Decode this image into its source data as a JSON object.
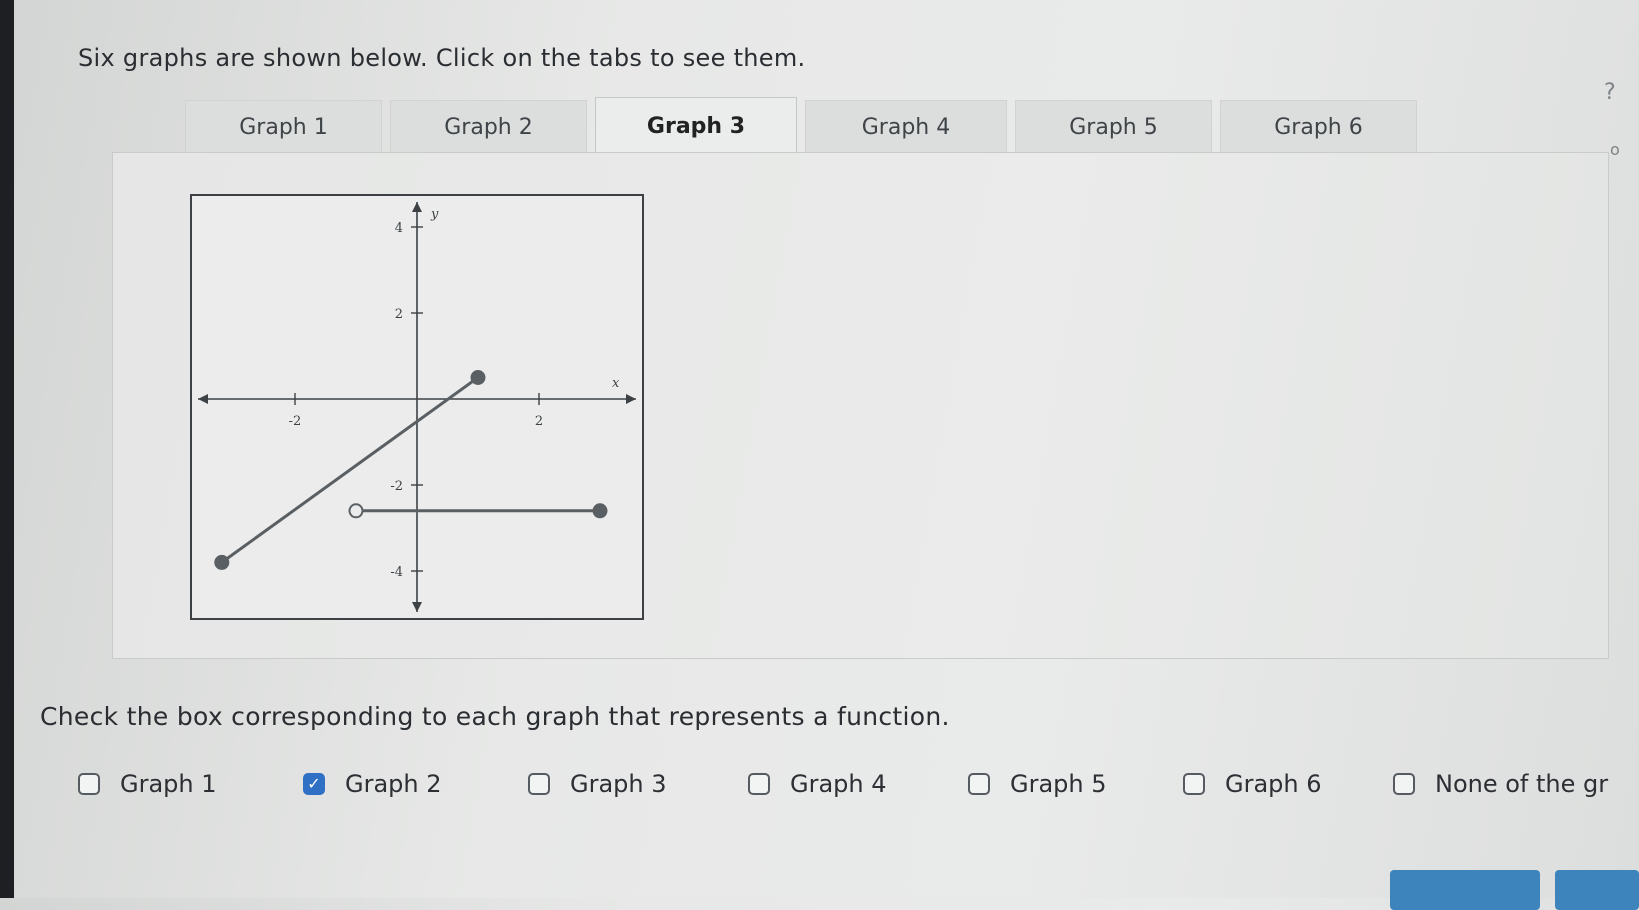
{
  "instructions": "Six graphs are shown below. Click on the tabs to see them.",
  "help_mark": "?",
  "side_mark": "o",
  "tabs": [
    {
      "label": "Graph 1",
      "active": false
    },
    {
      "label": "Graph 2",
      "active": false
    },
    {
      "label": "Graph 3",
      "active": true
    },
    {
      "label": "Graph 4",
      "active": false
    },
    {
      "label": "Graph 5",
      "active": false
    },
    {
      "label": "Graph 6",
      "active": false
    }
  ],
  "chart_data": {
    "type": "line",
    "xlabel": "x",
    "ylabel": "y",
    "xlim": [
      -3.5,
      3.5
    ],
    "ylim": [
      -5,
      5
    ],
    "x_ticks": [
      "-2",
      "2"
    ],
    "y_ticks": [
      "4",
      "2",
      "-2",
      "-4"
    ],
    "segments": [
      {
        "from": [
          -3.2,
          -3.8
        ],
        "to": [
          1,
          0.5
        ],
        "from_marker": "closed",
        "to_marker": "closed"
      },
      {
        "from": [
          -1,
          -2.6
        ],
        "to": [
          3,
          -2.6
        ],
        "from_marker": "open",
        "to_marker": "closed"
      }
    ],
    "colors": {
      "line": "#5a5f63",
      "axis": "#3d4145"
    }
  },
  "question": "Check the box corresponding to each graph that represents a function.",
  "options": [
    {
      "label": "Graph 1",
      "checked": false
    },
    {
      "label": "Graph 2",
      "checked": true
    },
    {
      "label": "Graph 3",
      "checked": false
    },
    {
      "label": "Graph 4",
      "checked": false
    },
    {
      "label": "Graph 5",
      "checked": false
    },
    {
      "label": "Graph 6",
      "checked": false
    },
    {
      "label": "None of the gr",
      "checked": false
    }
  ],
  "colors": {
    "check": "#2f6fc4",
    "button": "#3c84bb"
  }
}
